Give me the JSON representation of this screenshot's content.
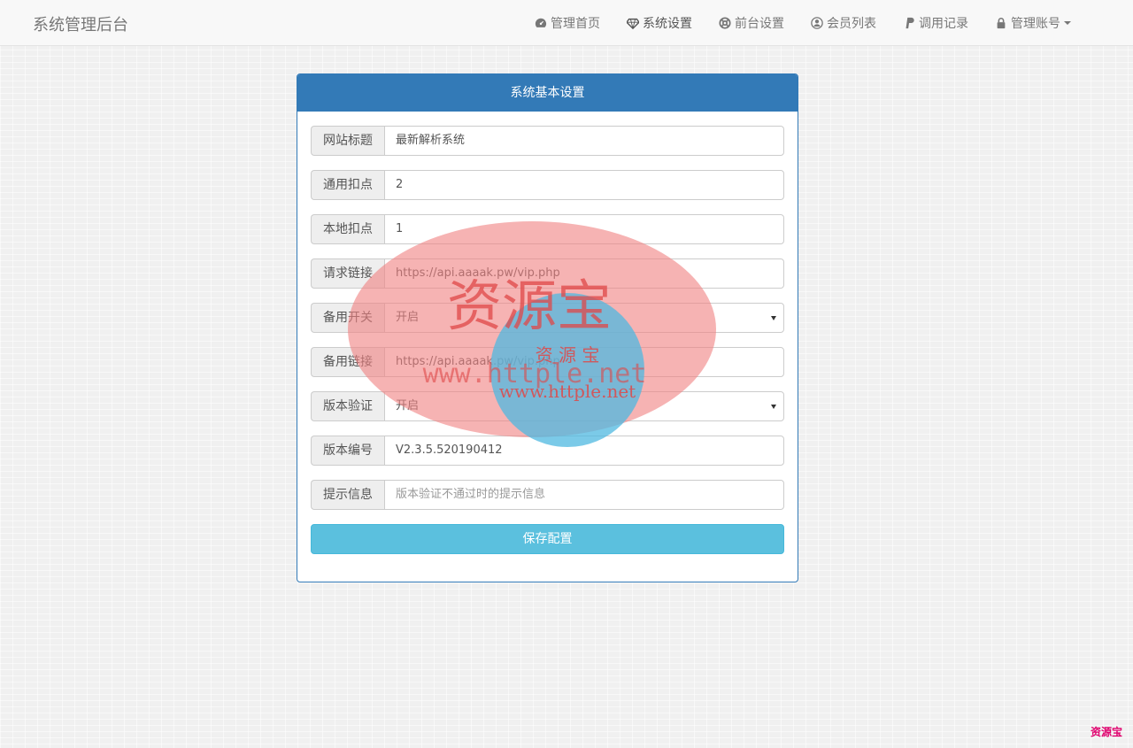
{
  "nav": {
    "brand": "系统管理后台",
    "items": [
      {
        "label": "管理首页"
      },
      {
        "label": "系统设置"
      },
      {
        "label": "前台设置"
      },
      {
        "label": "会员列表"
      },
      {
        "label": "调用记录"
      },
      {
        "label": "管理账号"
      }
    ]
  },
  "panel": {
    "title": "系统基本设置",
    "fields": [
      {
        "label": "网站标题",
        "value": "最新解析系统"
      },
      {
        "label": "通用扣点",
        "value": "2"
      },
      {
        "label": "本地扣点",
        "value": "1"
      },
      {
        "label": "请求链接",
        "value": "https://api.aaaak.pw/vip.php"
      },
      {
        "label": "备用开关",
        "value": "开启"
      },
      {
        "label": "备用链接",
        "value": "https://api.aaaak.pw/vip.php"
      },
      {
        "label": "版本验证",
        "value": "开启"
      },
      {
        "label": "版本编号",
        "value": "V2.3.5.520190412"
      },
      {
        "label": "提示信息",
        "placeholder": "版本验证不通过时的提示信息"
      }
    ],
    "save_label": "保存配置"
  },
  "watermark": {
    "big_text": "资源宝",
    "small_text": "资 源 宝",
    "url_text": "www.httple.net",
    "url_text_small": "www.httple.net",
    "corner_text": "资源宝",
    "red_color": "#f08080",
    "blue_color": "#4fb8e0"
  }
}
